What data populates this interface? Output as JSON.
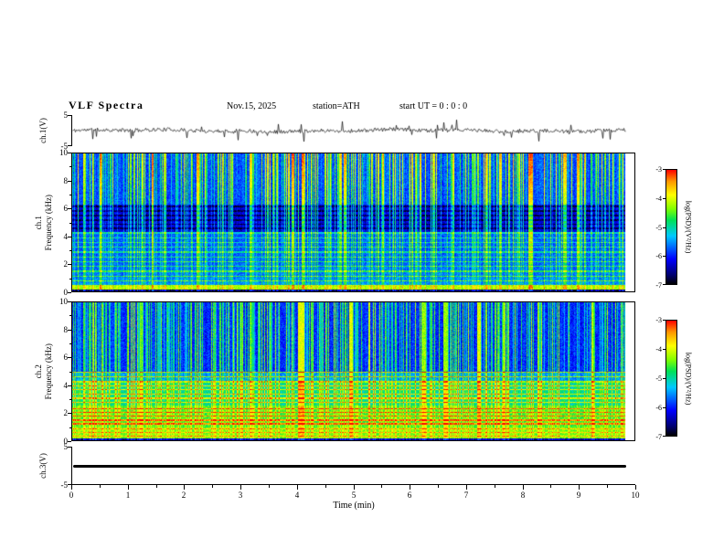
{
  "header": {
    "title": "VLF  Spectra",
    "date": "Nov.15, 2025",
    "station": "station=ATH",
    "start_ut": "start UT =   0 : 0 : 0"
  },
  "time_axis": {
    "label": "Time  (min)",
    "min": 0,
    "max": 10,
    "major_ticks": [
      0,
      1,
      2,
      3,
      4,
      5,
      6,
      7,
      8,
      9,
      10
    ],
    "minor_tick_step": 0.5,
    "data_end_min": 9.85
  },
  "colorbar": {
    "label": "log(PSD)/(V²/Hz)",
    "min": -7,
    "max": -3,
    "ticks": [
      -3,
      -4,
      -5,
      -6,
      -7
    ],
    "colormap": "jet with black floor (red=-3 high ... blue/black=-7 low)"
  },
  "chart_data": [
    {
      "id": "ch1_waveform",
      "type": "line",
      "channel_label": "ch.1(V)",
      "ylim": [
        -5,
        5
      ],
      "yticks": [
        5,
        -5
      ],
      "x_range_min": [
        0,
        9.85
      ],
      "description": "broadband noisy voltage trace fluctuating around 0 V with frequent impulsive spikes up to about ±3 V",
      "baseline_v": 0,
      "noise_amplitude_v": 0.6,
      "spike_amplitude_v": 2.4,
      "spike_probability": 0.05,
      "seed": 11
    },
    {
      "id": "ch1_spectrogram",
      "type": "heatmap",
      "subtype": "VLF spectrogram",
      "channel_label": "ch.1",
      "ylabel": "Frequency (kHz)",
      "ylim": [
        0,
        10
      ],
      "yticks": [
        0,
        2,
        4,
        6,
        8,
        10
      ],
      "xlim_min": [
        0,
        10
      ],
      "value_range_log_psd": [
        -7,
        -3
      ],
      "seed": 23,
      "features": {
        "background_level": -6.0,
        "dark_band_kHz": [
          4.3,
          6.3
        ],
        "dark_band_level": -6.6,
        "harmonic_line_spacing_kHz": 0.35,
        "low_band_kHz": [
          0.12,
          0.42
        ],
        "low_band_level": -4.35,
        "bottom_row_level": -6.8,
        "vertical_stripe_probability": 0.42,
        "vertical_stripe_boost": [
          0.8,
          2.6
        ],
        "description": "blue background with dense vertical sferic stripes (cyan/green/yellow), dark-blue banded region 4.3–6.3 kHz, fine green horizontal harmonic lines below 4 kHz, bright green-yellow band near 0.3 kHz, dark row at 0 kHz"
      }
    },
    {
      "id": "ch2_spectrogram",
      "type": "heatmap",
      "subtype": "VLF spectrogram",
      "channel_label": "ch.2",
      "ylabel": "Frequency (kHz)",
      "ylim": [
        0,
        10
      ],
      "yticks": [
        0,
        2,
        4,
        6,
        8,
        10
      ],
      "xlim_min": [
        0,
        10
      ],
      "value_range_log_psd": [
        -7,
        -3
      ],
      "seed": 57,
      "features": {
        "upper_band_kHz": [
          5,
          10
        ],
        "upper_background_level": -6.15,
        "mid_band_kHz": [
          2.5,
          5
        ],
        "mid_band_level": -5.1,
        "low_band_kHz": [
          0.12,
          2.5
        ],
        "low_band_level": -4.7,
        "harmonic_line_spacing_kHz": 0.3,
        "bottom_row_level": -6.6,
        "vertical_stripe_probability": 0.45,
        "vertical_stripe_boost": [
          0.8,
          2.4
        ],
        "description": "blue striped region above 5 kHz; strong green background with yellow/orange horizontal power-line harmonics below 4 kHz; brightest (orange) lines between 1 and 2.5 kHz; dark thin band at 0 kHz"
      }
    },
    {
      "id": "ch3_waveform",
      "type": "line",
      "channel_label": "ch.3(V)",
      "ylim": [
        -5,
        5
      ],
      "yticks": [
        5,
        -5
      ],
      "x_range_min": [
        0,
        9.85
      ],
      "description": "flat dead-channel trace: thick constant black line at about -0.2 V",
      "constant_v": -0.2,
      "line_thickness_px": 3
    }
  ]
}
